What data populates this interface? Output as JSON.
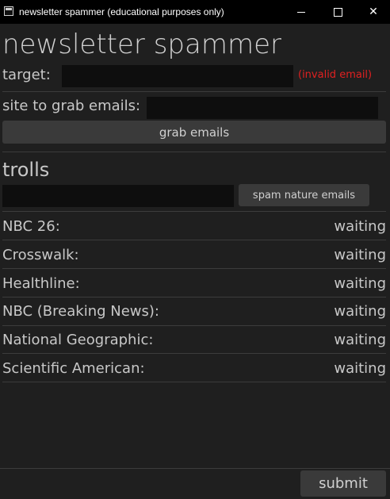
{
  "window": {
    "title": "newsletter spammer (educational purposes only)"
  },
  "header": {
    "title": "newsletter spammer"
  },
  "target": {
    "label": "target:",
    "value": "",
    "error": "(invalid email)"
  },
  "grab": {
    "label": "site to grab emails:",
    "value": "",
    "button_label": "grab emails"
  },
  "trolls": {
    "title": "trolls",
    "value": "",
    "button_label": "spam nature emails"
  },
  "newsletters": [
    {
      "name": "NBC 26:",
      "status": "waiting"
    },
    {
      "name": "Crosswalk:",
      "status": "waiting"
    },
    {
      "name": "Healthline:",
      "status": "waiting"
    },
    {
      "name": "NBC (Breaking News):",
      "status": "waiting"
    },
    {
      "name": "National Geographic:",
      "status": "waiting"
    },
    {
      "name": "Scientific American:",
      "status": "waiting"
    }
  ],
  "footer": {
    "submit_label": "submit"
  },
  "colors": {
    "background": "#1f1f1f",
    "field": "#0e0e0e",
    "button": "#3a3a3a",
    "error": "#e02020",
    "text": "#c8c8c8"
  },
  "icons": [
    "app-icon",
    "minimize-icon",
    "maximize-icon",
    "close-icon"
  ]
}
